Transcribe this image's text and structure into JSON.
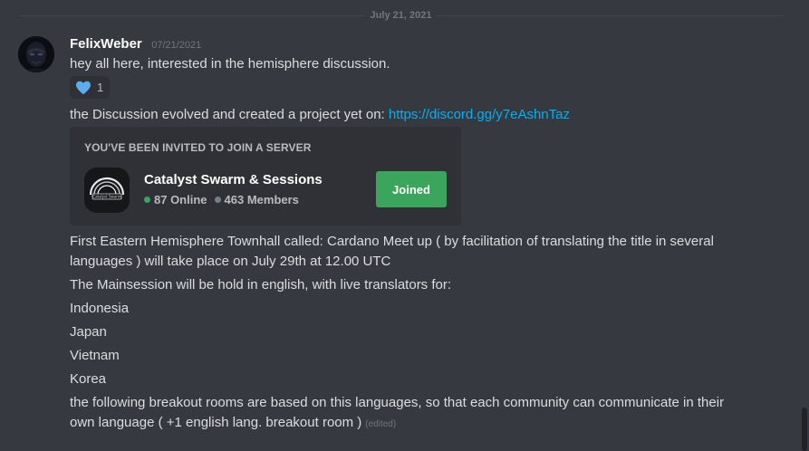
{
  "date_divider": "July 21, 2021",
  "message": {
    "author": "FelixWeber",
    "timestamp": "07/21/2021",
    "line1": "hey all here, interested in the hemisphere discussion.",
    "reaction": {
      "icon": "heart-icon",
      "count": "1"
    },
    "line2_text": "the Discussion evolved and created a project yet on: ",
    "line2_link": "https://discord.gg/y7eAshnTaz",
    "invite": {
      "heading": "YOU'VE BEEN INVITED TO JOIN A SERVER",
      "server_name": "Catalyst Swarm & Sessions",
      "online": "87 Online",
      "members": "463 Members",
      "button": "Joined",
      "icon_text": "Catalyst Swarm"
    },
    "paragraph1_line1": "First Eastern Hemisphere Townhall called: Cardano Meet up ( by facilitation of translating the title in several",
    "paragraph1_line2": "languages ) will take place on July 29th at 12.00 UTC",
    "line_mainsession": "The Mainsession will be hold in english, with live translators for:",
    "languages": [
      "Indonesia",
      "Japan",
      "Vietnam",
      "Korea"
    ],
    "closing_line1": "the following breakout rooms are based on this languages, so that each community can communicate in their",
    "closing_line2": "own language ( +1 english lang. breakout room )",
    "edited": "(edited)"
  },
  "colors": {
    "background": "#36393f",
    "link": "#00b0f4",
    "join_button": "#3ba55d",
    "online_dot": "#3ba55d",
    "heart": "#5dadec"
  }
}
